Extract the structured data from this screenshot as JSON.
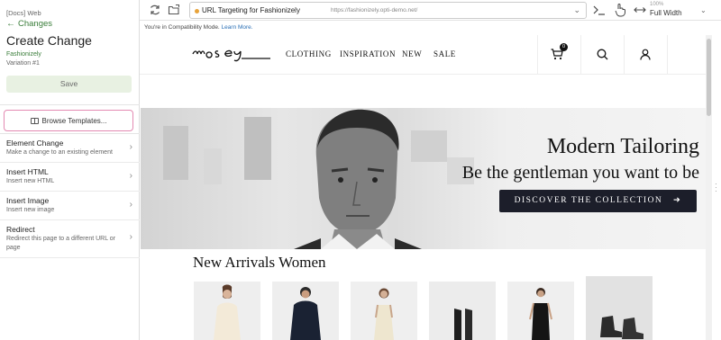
{
  "editor": {
    "project_label": "[Docs] Web",
    "back_label": "Changes",
    "title": "Create Change",
    "project_name": "Fashionizely",
    "variation": "Variation #1",
    "save_label": "Save",
    "browse_label": "Browse Templates...",
    "options": [
      {
        "title": "Element Change",
        "desc": "Make a change to an existing element"
      },
      {
        "title": "Insert HTML",
        "desc": "Insert new HTML"
      },
      {
        "title": "Insert Image",
        "desc": "Insert new image"
      },
      {
        "title": "Redirect",
        "desc": "Redirect this page to a different URL or page"
      }
    ]
  },
  "toolbar": {
    "url_title": "URL Targeting for Fashionizely",
    "url": "https://fashionizely.opti-demo.net/",
    "zoom": "100%",
    "width_mode": "Full Width"
  },
  "site": {
    "compat_text": "You're in Compatibility Mode.",
    "learn_more": "Learn More.",
    "logo": "mosey",
    "nav": [
      "CLOTHING",
      "INSPIRATION",
      "NEW",
      "SALE"
    ],
    "cart_count": "0",
    "hero_title": "Modern Tailoring",
    "hero_subtitle": "Be the gentleman you want to be",
    "cta_label": "DISCOVER THE COLLECTION",
    "section_title": "New Arrivals Women"
  },
  "colors": {
    "accent_green": "#3a7d3a",
    "template_border": "#e38ab2",
    "cta_bg": "#1c1e2a",
    "status_dot": "#e8a33a"
  }
}
